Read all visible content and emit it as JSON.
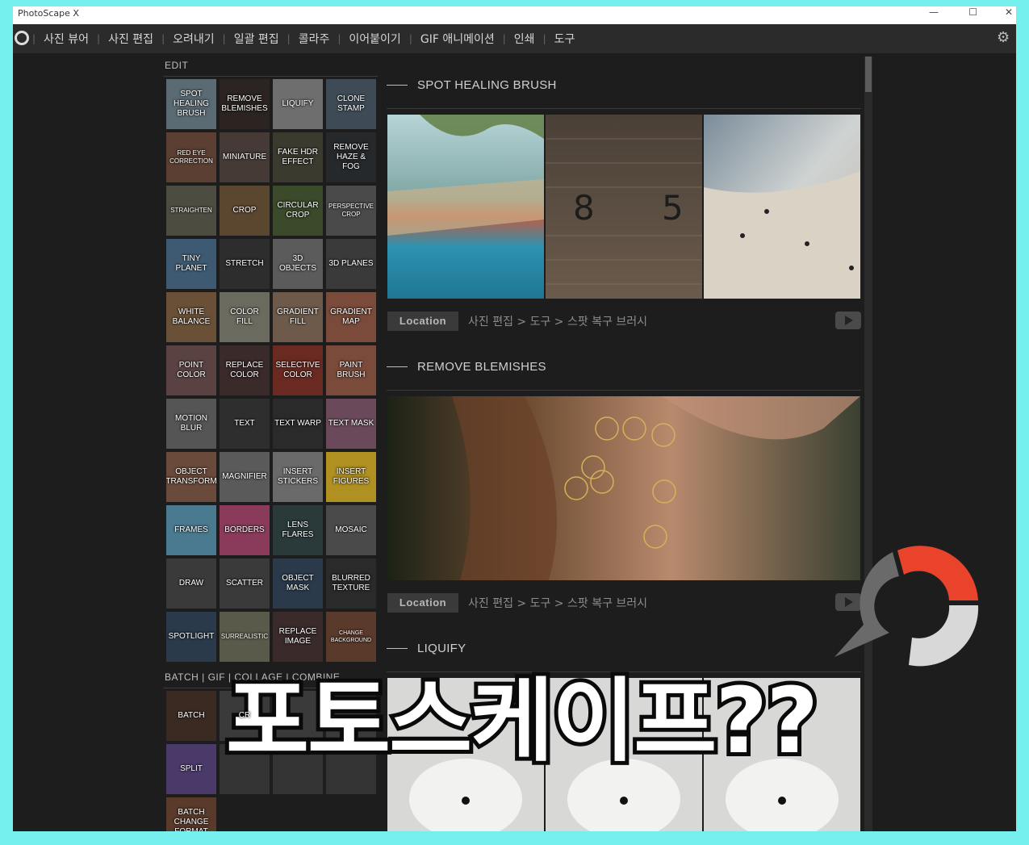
{
  "window": {
    "title": "PhotoScape X",
    "controls": [
      "—",
      "☐",
      "✕"
    ]
  },
  "menu": {
    "items": [
      "사진 뷰어",
      "사진 편집",
      "오려내기",
      "일괄 편집",
      "콜라주",
      "이어붙이기",
      "GIF 애니메이션",
      "인쇄",
      "도구"
    ],
    "separator": "|"
  },
  "sidebar": {
    "edit_label": "EDIT",
    "edit_tools": [
      {
        "label": "SPOT HEALING BRUSH",
        "bg": "#5a6b74"
      },
      {
        "label": "REMOVE BLEMISHES",
        "bg": "#2b2420"
      },
      {
        "label": "LIQUIFY",
        "bg": "#6e6e6e"
      },
      {
        "label": "CLONE STAMP",
        "bg": "#3e4b57"
      },
      {
        "label": "RED EYE CORRECTION",
        "bg": "#5b3f32",
        "size": "small"
      },
      {
        "label": "MINIATURE",
        "bg": "#453a36"
      },
      {
        "label": "FAKE HDR EFFECT",
        "bg": "#3a3a2f"
      },
      {
        "label": "REMOVE HAZE & FOG",
        "bg": "#26292b"
      },
      {
        "label": "STRAIGHTEN",
        "bg": "#4c4c40",
        "size": "small"
      },
      {
        "label": "CROP",
        "bg": "#5b4630"
      },
      {
        "label": "CIRCULAR CROP",
        "bg": "#3a4a2a"
      },
      {
        "label": "PERSPECTIVE CROP",
        "bg": "#4a4a4a",
        "size": "small"
      },
      {
        "label": "TINY PLANET",
        "bg": "#3e5a72"
      },
      {
        "label": "STRETCH",
        "bg": "#2d2d2d"
      },
      {
        "label": "3D OBJECTS",
        "bg": "#5b5b5b"
      },
      {
        "label": "3D PLANES",
        "bg": "#3a3a3a"
      },
      {
        "label": "WHITE BALANCE",
        "bg": "#6a5036"
      },
      {
        "label": "COLOR FILL",
        "bg": "#6a6a5e"
      },
      {
        "label": "GRADIENT FILL",
        "bg": "#6d5a4a"
      },
      {
        "label": "GRADIENT MAP",
        "bg": "#7a4a3a"
      },
      {
        "label": "POINT COLOR",
        "bg": "#5a4242"
      },
      {
        "label": "REPLACE COLOR",
        "bg": "#3a2a2a"
      },
      {
        "label": "SELECTIVE COLOR",
        "bg": "#6a2a22"
      },
      {
        "label": "PAINT BRUSH",
        "bg": "#7a4a3a"
      },
      {
        "label": "MOTION BLUR",
        "bg": "#555555"
      },
      {
        "label": "TEXT",
        "bg": "#2e2e2e"
      },
      {
        "label": "TEXT WARP",
        "bg": "#2a2a2a"
      },
      {
        "label": "TEXT MASK",
        "bg": "#6a4a5a"
      },
      {
        "label": "OBJECT TRANSFORM",
        "bg": "#6a4a3a"
      },
      {
        "label": "MAGNIFIER",
        "bg": "#5a5a5a"
      },
      {
        "label": "INSERT STICKERS",
        "bg": "#6a6a6a"
      },
      {
        "label": "INSERT FIGURES",
        "bg": "#b09020"
      },
      {
        "label": "FRAMES",
        "bg": "#4a7a90"
      },
      {
        "label": "BORDERS",
        "bg": "#8a3a5a"
      },
      {
        "label": "LENS FLARES",
        "bg": "#2a3a3a"
      },
      {
        "label": "MOSAIC",
        "bg": "#4a4a4a"
      },
      {
        "label": "DRAW",
        "bg": "#3a3a3a"
      },
      {
        "label": "SCATTER",
        "bg": "#3a3a3a"
      },
      {
        "label": "OBJECT MASK",
        "bg": "#2a3a4a"
      },
      {
        "label": "BLURRED TEXTURE",
        "bg": "#2a2a2a"
      },
      {
        "label": "SPOTLIGHT",
        "bg": "#2a3a4a"
      },
      {
        "label": "SURREALISTIC",
        "bg": "#5a5a4a",
        "size": "small"
      },
      {
        "label": "REPLACE IMAGE",
        "bg": "#3a2a2a"
      },
      {
        "label": "CHANGE BACKGROUND",
        "bg": "#5a3a2a",
        "size": "xsmall"
      }
    ],
    "batch_label": "BATCH | GIF | COLLAGE | COMBINE",
    "batch_tools": [
      {
        "label": "BATCH",
        "bg": "#3a2a22"
      },
      {
        "label": "CR",
        "bg": "#3a3a3a"
      },
      {
        "label": "",
        "bg": "#3a3a3a"
      },
      {
        "label": "",
        "bg": "#3a3a3a"
      },
      {
        "label": "SPLIT",
        "bg": "#4a3a6a"
      },
      {
        "label": "",
        "bg": "#333333"
      },
      {
        "label": "",
        "bg": "#333333"
      },
      {
        "label": "",
        "bg": "#333333"
      },
      {
        "label": "BATCH CHANGE FORMAT",
        "bg": "#5a3a2a"
      }
    ]
  },
  "sections": [
    {
      "title": "SPOT HEALING BRUSH",
      "location_tag": "Location",
      "path": "사진 편집 > 도구 > 스팟 복구 브러시"
    },
    {
      "title": "REMOVE BLEMISHES",
      "location_tag": "Location",
      "path": "사진 편집 > 도구 > 스팟 복구 브러시"
    },
    {
      "title": "LIQUIFY"
    }
  ],
  "overlay_text": "포토스케이프??",
  "colors": {
    "background": "#1d1d1d",
    "frame": "#76f0ee",
    "logo_red": "#e9432b"
  }
}
